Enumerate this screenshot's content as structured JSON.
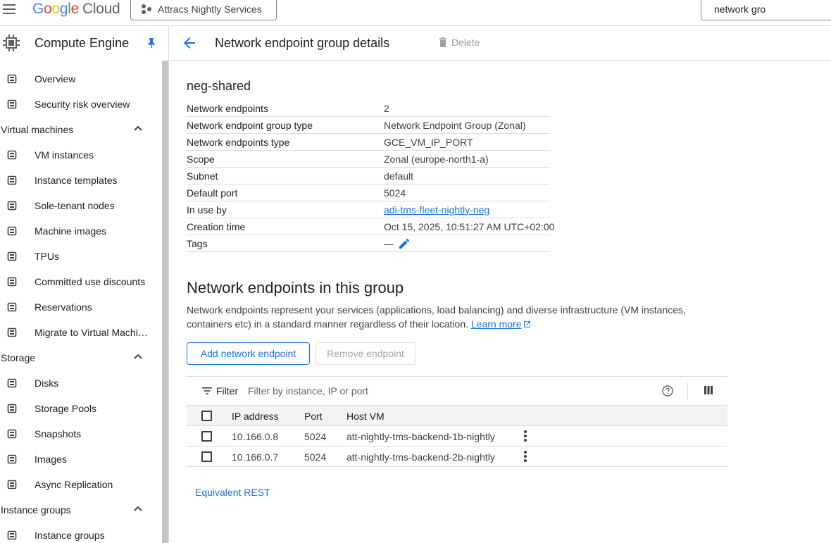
{
  "topbar": {
    "logo": {
      "g1": "G",
      "g2": "o",
      "g3": "o",
      "g4": "g",
      "g5": "l",
      "g6": "e",
      "cloud": "Cloud"
    },
    "project_name": "Attracs Nightly Services",
    "search_value": "network gro"
  },
  "sidebar": {
    "title": "Compute Engine",
    "items": [
      {
        "type": "item",
        "label": "Overview",
        "icon": "dashboard-icon"
      },
      {
        "type": "item",
        "label": "Security risk overview",
        "icon": "shield-icon"
      },
      {
        "type": "section",
        "label": "Virtual machines"
      },
      {
        "type": "item",
        "label": "VM instances",
        "icon": "vm-icon"
      },
      {
        "type": "item",
        "label": "Instance templates",
        "icon": "template-icon"
      },
      {
        "type": "item",
        "label": "Sole-tenant nodes",
        "icon": "sole-tenant-icon"
      },
      {
        "type": "item",
        "label": "Machine images",
        "icon": "machine-image-icon"
      },
      {
        "type": "item",
        "label": "TPUs",
        "icon": "tpu-icon"
      },
      {
        "type": "item",
        "label": "Committed use discounts",
        "icon": "percent-icon"
      },
      {
        "type": "item",
        "label": "Reservations",
        "icon": "calendar-icon"
      },
      {
        "type": "item",
        "label": "Migrate to Virtual Machines",
        "icon": "migrate-icon"
      },
      {
        "type": "section",
        "label": "Storage"
      },
      {
        "type": "item",
        "label": "Disks",
        "icon": "disk-icon"
      },
      {
        "type": "item",
        "label": "Storage Pools",
        "icon": "storage-pool-icon"
      },
      {
        "type": "item",
        "label": "Snapshots",
        "icon": "snapshot-icon"
      },
      {
        "type": "item",
        "label": "Images",
        "icon": "images-icon"
      },
      {
        "type": "item",
        "label": "Async Replication",
        "icon": "replication-icon"
      },
      {
        "type": "section",
        "label": "Instance groups"
      },
      {
        "type": "item",
        "label": "Instance groups",
        "icon": "instance-groups-icon"
      }
    ]
  },
  "page": {
    "title": "Network endpoint group details",
    "delete_label": "Delete",
    "neg_name": "neg-shared",
    "properties": [
      {
        "key": "Network endpoints",
        "value": "2"
      },
      {
        "key": "Network endpoint group type",
        "value": "Network Endpoint Group (Zonal)"
      },
      {
        "key": "Network endpoints type",
        "value": "GCE_VM_IP_PORT"
      },
      {
        "key": "Scope",
        "value": "Zonal (europe-north1-a)"
      },
      {
        "key": "Subnet",
        "value": "default"
      },
      {
        "key": "Default port",
        "value": "5024"
      },
      {
        "key": "In use by",
        "value": "adi-tms-fleet-nightly-neg",
        "link": true
      },
      {
        "key": "Creation time",
        "value": "Oct 15, 2025, 10:51:27 AM UTC+02:00"
      },
      {
        "key": "Tags",
        "value": "—",
        "editable": true
      }
    ],
    "endpoints_section": {
      "title": "Network endpoints in this group",
      "description": "Network endpoints represent your services (applications, load balancing) and diverse infrastructure (VM instances, containers etc) in a standard manner regardless of their location.",
      "learn_more": "Learn more",
      "add_button": "Add network endpoint",
      "remove_button": "Remove endpoint",
      "filter_label": "Filter",
      "filter_placeholder": "Filter by instance, IP or port",
      "columns": {
        "ip": "IP address",
        "port": "Port",
        "host": "Host VM"
      },
      "rows": [
        {
          "ip": "10.166.0.8",
          "port": "5024",
          "host": "att-nightly-tms-backend-1b-nightly"
        },
        {
          "ip": "10.166.0.7",
          "port": "5024",
          "host": "att-nightly-tms-backend-2b-nightly"
        }
      ]
    },
    "equivalent_rest": "Equivalent REST"
  },
  "colors": {
    "accent": "#1a73e8",
    "text": "#202124",
    "muted": "#5f6368",
    "border": "#dadce0"
  }
}
